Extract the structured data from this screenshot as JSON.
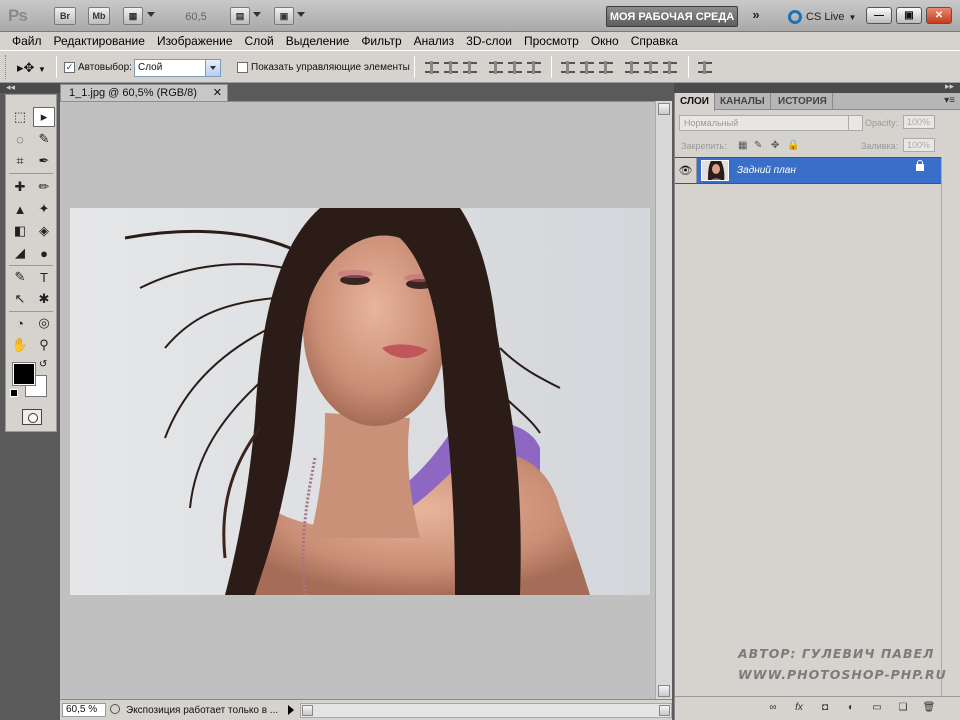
{
  "app": {
    "logo": "Ps",
    "bridge_btn": "Br",
    "minibridge_btn": "Mb",
    "zoom_value": "60,5",
    "workspace_label": "МОЯ РАБОЧАЯ СРЕДА",
    "more_label": "»",
    "cslive_label": "CS Live",
    "win_min": "—",
    "win_max": "▣",
    "win_close": "✕"
  },
  "menu": [
    "Файл",
    "Редактирование",
    "Изображение",
    "Слой",
    "Выделение",
    "Фильтр",
    "Анализ",
    "3D-слои",
    "Просмотр",
    "Окно",
    "Справка"
  ],
  "options": {
    "autoselect_label": "Автовыбор:",
    "autoselect_checked": "✓",
    "layer_select_value": "Слой",
    "show_controls_label": "Показать управляющие элементы"
  },
  "tools": {
    "collapse_label": "◂◂",
    "items": [
      "⬚",
      "▸",
      "◌",
      "✎",
      "⌗",
      "✒",
      "✚",
      "✏",
      "▲",
      "✦",
      "◧",
      "◈",
      "◢",
      "●",
      "✎",
      "T",
      "↖",
      "✱",
      "◔",
      "◎",
      "✋",
      "⚲"
    ]
  },
  "document": {
    "tab_title": "1_1.jpg @ 60,5% (RGB/8)",
    "tab_close": "✕",
    "status_zoom": "60,5 %",
    "status_info": "Экспозиция работает только в ..."
  },
  "panel": {
    "collapse_label": "▸▸",
    "tabs": [
      "СЛОИ",
      "КАНАЛЫ",
      "ИСТОРИЯ"
    ],
    "menu_icon": "▾≡",
    "blend_mode": "Нормальный",
    "opacity_label": "Opacity:",
    "opacity_value": "100%",
    "lock_label": "Закрепить:",
    "fill_label": "Заливка:",
    "fill_value": "100%",
    "layer_name": "Задний план",
    "eye": "👁",
    "bottom_icons": [
      "∞",
      "fx",
      "◘",
      "◐",
      "▭",
      "❑",
      "🗑"
    ]
  },
  "watermark": {
    "line1": "АВТОР: ГУЛЕВИЧ ПАВЕЛ",
    "line2": "WWW.PHOTOSHOP-PHP.RU"
  }
}
